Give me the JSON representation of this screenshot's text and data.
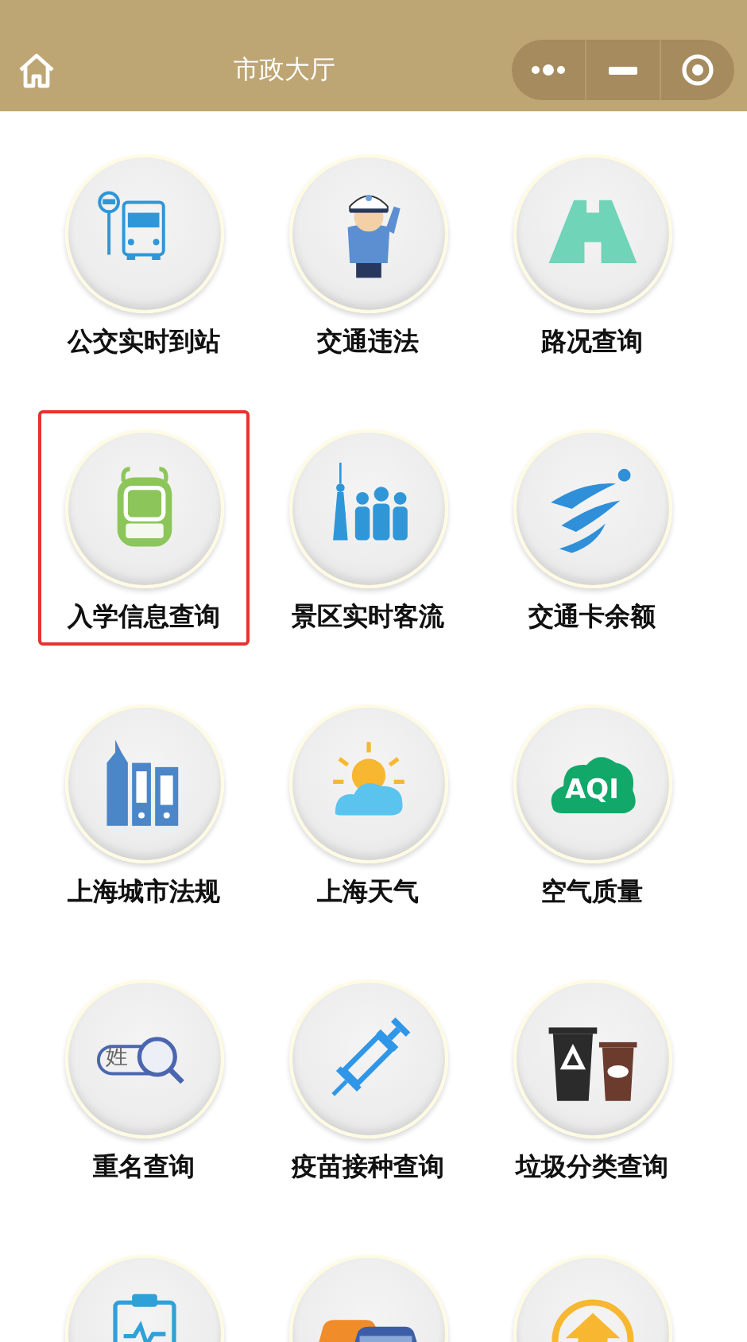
{
  "header": {
    "title": "市政大厅"
  },
  "services": [
    {
      "kind": "bus",
      "label": "公交实时到站",
      "selected": false
    },
    {
      "kind": "police",
      "label": "交通违法",
      "selected": false
    },
    {
      "kind": "road",
      "label": "路况查询",
      "selected": false
    },
    {
      "kind": "backpack",
      "label": "入学信息查询",
      "selected": true
    },
    {
      "kind": "tower",
      "label": "景区实时客流",
      "selected": false
    },
    {
      "kind": "runner",
      "label": "交通卡余额",
      "selected": false
    },
    {
      "kind": "buildings",
      "label": "上海城市法规",
      "selected": false
    },
    {
      "kind": "weather",
      "label": "上海天气",
      "selected": false
    },
    {
      "kind": "cloud",
      "label": "空气质量",
      "icon_text": "AQI",
      "selected": false
    },
    {
      "kind": "namesearch",
      "label": "重名查询",
      "icon_text": "姓",
      "selected": false
    },
    {
      "kind": "syringe",
      "label": "疫苗接种查询",
      "selected": false
    },
    {
      "kind": "bins",
      "label": "垃圾分类查询",
      "selected": false
    },
    {
      "kind": "clipboard",
      "selected": false
    },
    {
      "kind": "cars",
      "selected": false
    },
    {
      "kind": "home",
      "selected": false
    }
  ]
}
